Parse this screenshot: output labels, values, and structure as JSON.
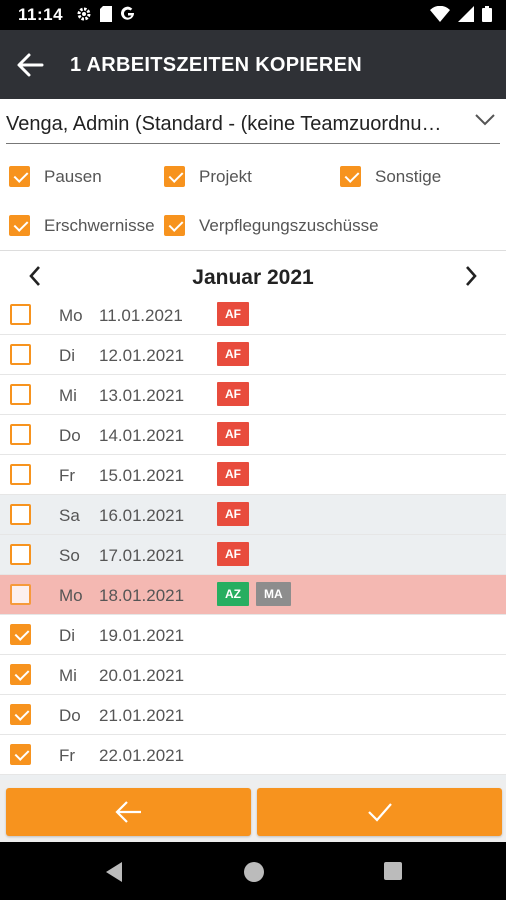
{
  "status": {
    "time": "11:14"
  },
  "appbar": {
    "title": "1 ARBEITSZEITEN KOPIEREN"
  },
  "user_select": {
    "value": "Venga, Admin (Standard - (keine Teamzuordnu…"
  },
  "filters": [
    {
      "label": "Pausen",
      "checked": true
    },
    {
      "label": "Projekt",
      "checked": true
    },
    {
      "label": "Sonstige",
      "checked": true
    },
    {
      "label": "Erschwernisse",
      "checked": true
    },
    {
      "label": "Verpflegungszuschüsse",
      "checked": true
    }
  ],
  "month": {
    "label": "Januar 2021"
  },
  "days": [
    {
      "day": "Mo",
      "date": "11.01.2021",
      "checked": false,
      "badges": [
        "AF"
      ]
    },
    {
      "day": "Di",
      "date": "12.01.2021",
      "checked": false,
      "badges": [
        "AF"
      ]
    },
    {
      "day": "Mi",
      "date": "13.01.2021",
      "checked": false,
      "badges": [
        "AF"
      ]
    },
    {
      "day": "Do",
      "date": "14.01.2021",
      "checked": false,
      "badges": [
        "AF"
      ]
    },
    {
      "day": "Fr",
      "date": "15.01.2021",
      "checked": false,
      "badges": [
        "AF"
      ]
    },
    {
      "day": "Sa",
      "date": "16.01.2021",
      "checked": false,
      "badges": [
        "AF"
      ]
    },
    {
      "day": "So",
      "date": "17.01.2021",
      "checked": false,
      "badges": [
        "AF"
      ]
    },
    {
      "day": "Mo",
      "date": "18.01.2021",
      "checked": false,
      "badges": [
        "AZ",
        "MA"
      ]
    },
    {
      "day": "Di",
      "date": "19.01.2021",
      "checked": true,
      "badges": []
    },
    {
      "day": "Mi",
      "date": "20.01.2021",
      "checked": true,
      "badges": []
    },
    {
      "day": "Do",
      "date": "21.01.2021",
      "checked": true,
      "badges": []
    },
    {
      "day": "Fr",
      "date": "22.01.2021",
      "checked": true,
      "badges": []
    }
  ],
  "colors": {
    "accent": "#f7931e",
    "appbar": "#2f3136",
    "badge_af": "#e84c3d",
    "badge_az": "#27ae60",
    "badge_ma": "#8d8d8d",
    "weekend_row": "#eceff1",
    "highlight_row": "#f4b8b2"
  },
  "icons": {
    "back": "arrow-left-icon",
    "dropdown": "chevron-down-icon",
    "prev_month": "chevron-left-icon",
    "next_month": "chevron-right-icon",
    "cancel": "arrow-left-icon",
    "confirm": "check-icon"
  }
}
